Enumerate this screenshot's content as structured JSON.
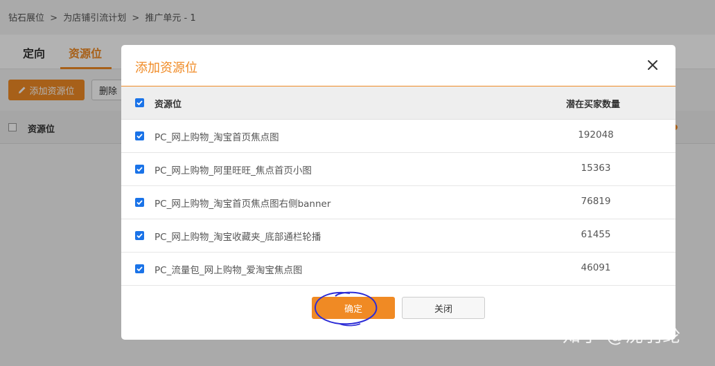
{
  "breadcrumb": [
    "钻石展位",
    ">",
    "为店铺引流计划",
    ">",
    "推广单元 - 1"
  ],
  "tabs": [
    {
      "label": "定向",
      "active": false
    },
    {
      "label": "资源位",
      "active": true
    }
  ],
  "toolbar": {
    "add_label": "添加资源位",
    "delete_label": "删除"
  },
  "background_table": {
    "header_label": "资源位"
  },
  "modal": {
    "title": "添加资源位",
    "columns": {
      "name": "资源位",
      "count": "潜在买家数量"
    },
    "rows": [
      {
        "name": "PC_网上购物_淘宝首页焦点图",
        "count": "192048",
        "checked": true
      },
      {
        "name": "PC_网上购物_阿里旺旺_焦点首页小图",
        "count": "15363",
        "checked": true
      },
      {
        "name": "PC_网上购物_淘宝首页焦点图右侧banner",
        "count": "76819",
        "checked": true
      },
      {
        "name": "PC_网上购物_淘宝收藏夹_底部通栏轮播",
        "count": "61455",
        "checked": true
      },
      {
        "name": "PC_流量包_网上购物_爱淘宝焦点图",
        "count": "46091",
        "checked": true
      }
    ],
    "confirm_label": "确定",
    "close_label": "关闭"
  },
  "watermark": "知乎 @沈羽纶",
  "colors": {
    "accent": "#f08a24",
    "checkbox": "#1a73e8",
    "annotation": "#2b2bd6"
  }
}
